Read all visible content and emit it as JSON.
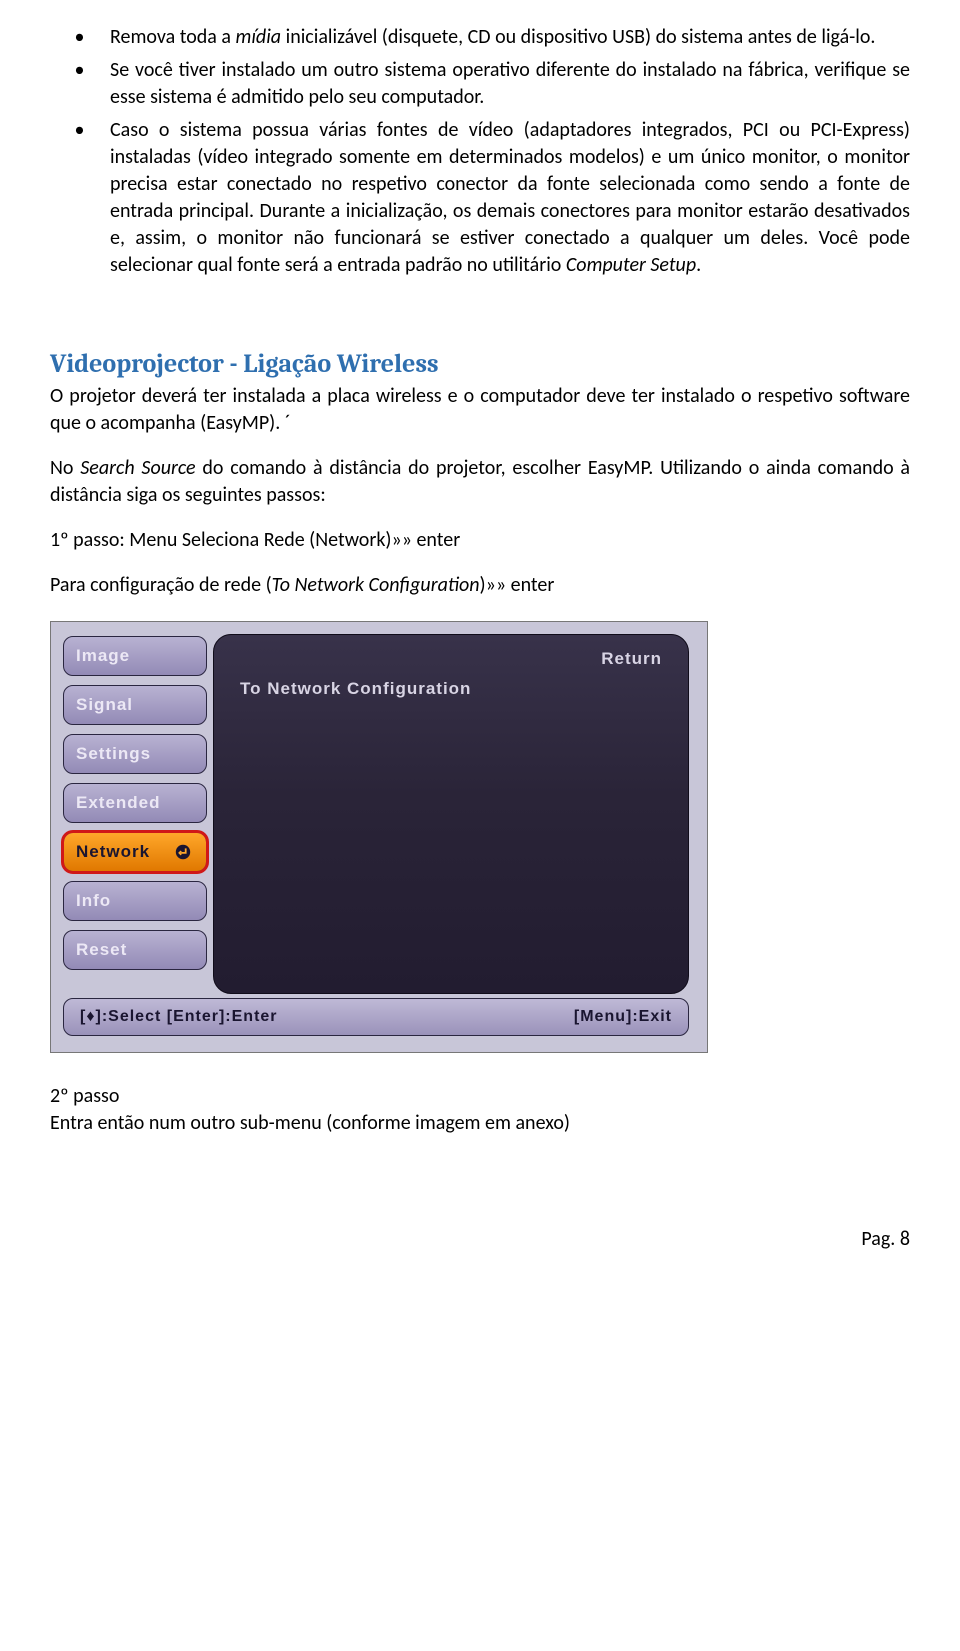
{
  "bullets": {
    "b1_a": "Remova toda a ",
    "b1_b": "mídia",
    "b1_c": " inicializável (disquete, CD ou dispositivo USB) do sistema antes de ligá-lo.",
    "b2": "Se você tiver instalado um outro sistema operativo diferente do instalado na fábrica, verifique se esse sistema é admitido pelo seu computador.",
    "b3_a": "Caso o sistema possua várias fontes de vídeo (adaptadores integrados, PCI ou PCI-Express) instaladas (vídeo integrado somente em determinados modelos) e um único monitor, o monitor precisa estar conectado no respetivo conector da fonte selecionada como sendo a fonte de entrada principal. Durante a inicialização, os demais conectores para monitor estarão desativados e, assim, o monitor não funcionará se estiver conectado a qualquer um deles. Você pode selecionar qual fonte será a entrada padrão no utilitário ",
    "b3_b": "Computer Setup",
    "b3_c": "."
  },
  "section_title": "Videoprojector - Ligação Wireless",
  "p_intro": "O projetor deverá ter instalada a placa wireless e o computador deve ter instalado o respetivo software que o acompanha (EasyMP). ´",
  "p_search_a": "No ",
  "p_search_b": "Search Source",
  "p_search_c": " do comando à distância do projetor, escolher EasyMP. Utilizando o ainda comando à distância siga os seguintes passos:",
  "p_passo1": "1º passo: Menu Seleciona Rede (Network)»» enter",
  "p_netconf_a": "Para configuração de rede (",
  "p_netconf_b": "To Network Configuration",
  "p_netconf_c": ")»» enter",
  "proj": {
    "menu": [
      "Image",
      "Signal",
      "Settings",
      "Extended",
      "Network",
      "Info",
      "Reset"
    ],
    "selected_index": 4,
    "panel_return": "Return",
    "panel_line": "To Network Configuration",
    "help_left": "[♦]:Select  [Enter]:Enter",
    "help_right": "[Menu]:Exit"
  },
  "p_passo2a": "2º passo",
  "p_passo2b": "Entra então num outro sub-menu (conforme imagem em anexo)",
  "footer": "Pag. 8"
}
